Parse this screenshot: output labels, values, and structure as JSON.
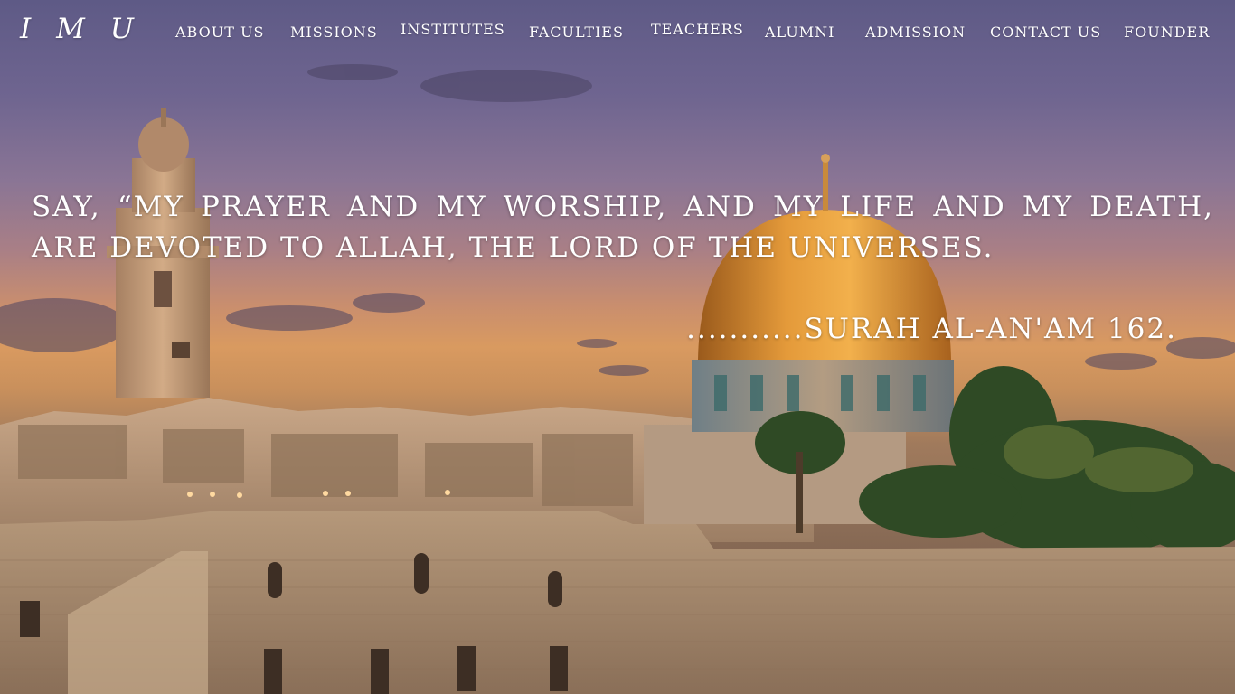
{
  "brand": {
    "logo_text": "I M U"
  },
  "nav": {
    "items": [
      {
        "label": "ABOUT US"
      },
      {
        "label": "MISSIONS"
      },
      {
        "label": "INSTITUTES"
      },
      {
        "label": "FACULTIES"
      },
      {
        "label": "TEACHERS"
      },
      {
        "label": "ALUMNI"
      },
      {
        "label": "ADMISSION"
      },
      {
        "label": "CONTACT US"
      },
      {
        "label": "FOUNDER"
      }
    ]
  },
  "hero": {
    "quote": "SAY, “MY PRAYER AND MY WORSHIP, AND MY LIFE AND MY DEATH, ARE DEVOTED TO ALLAH, THE LORD OF THE UNIVERSES.",
    "source": "...........SURAH AL-AN'AM 162.",
    "image_icon": "jerusalem-skyline-photo"
  },
  "colors": {
    "text": "#ffffff",
    "sky_top": "#5e5a86",
    "sky_sunset": "#d99a60",
    "dome_gold": "#d98a2e",
    "stone_wall": "#a58a6e"
  }
}
